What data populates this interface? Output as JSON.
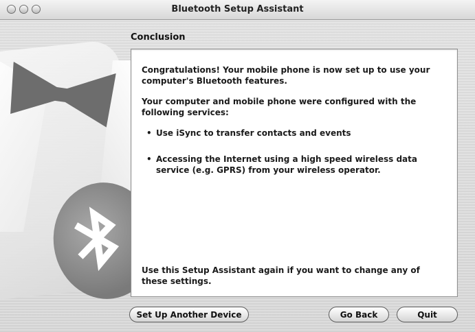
{
  "window": {
    "title": "Bluetooth Setup Assistant"
  },
  "section": {
    "title": "Conclusion"
  },
  "content": {
    "intro": "Congratulations! Your mobile phone is now set up to use your computer's Bluetooth features.",
    "services_heading": "Your computer and mobile phone were configured with the following services:",
    "services": [
      "Use iSync to transfer contacts and events",
      "Accessing the Internet using a high speed wireless data service (e.g. GPRS) from your wireless operator."
    ],
    "footer_note": "Use this Setup Assistant again if you want to change any of these settings."
  },
  "buttons": {
    "setup_another": "Set Up Another Device",
    "go_back": "Go Back",
    "quit": "Quit"
  },
  "icons": {
    "illustration": "bluetooth-icon",
    "bullet": "•"
  }
}
